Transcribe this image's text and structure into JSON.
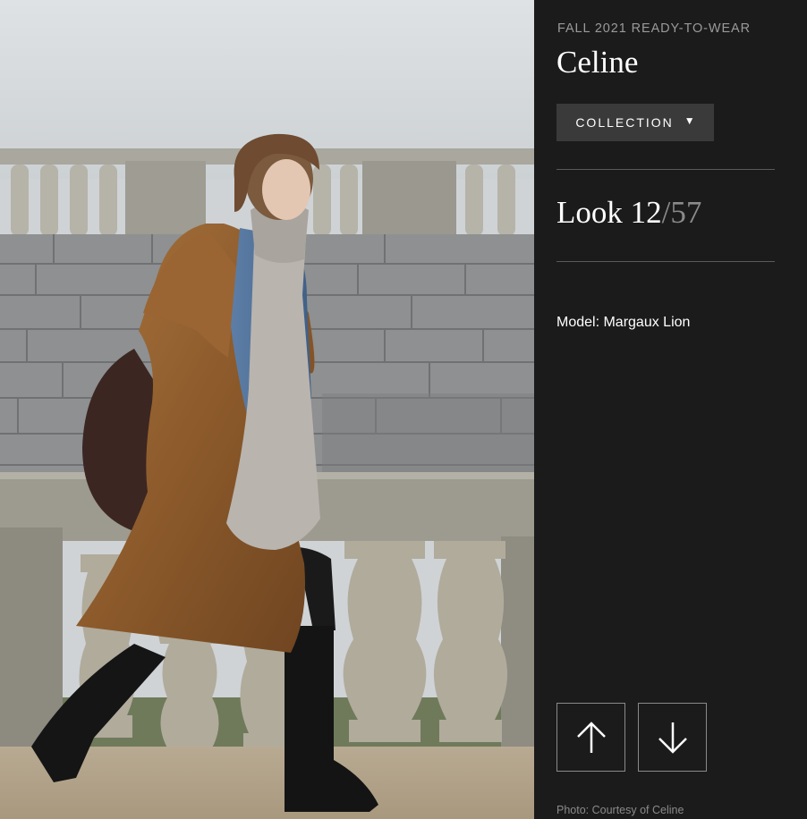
{
  "header": {
    "season": "FALL 2021 READY-TO-WEAR",
    "brand": "Celine"
  },
  "collection_button": {
    "label": "COLLECTION",
    "caret": "▼"
  },
  "look": {
    "prefix": "Look",
    "current": "12",
    "separator": "/",
    "total": "57"
  },
  "model": {
    "text": "Model: Margaux Lion"
  },
  "navigation": {
    "up_icon": "arrow-up-icon",
    "down_icon": "arrow-down-icon"
  },
  "credit": {
    "text": "Photo: Courtesy of Celine"
  },
  "colors": {
    "sidebar_bg": "#1b1b1b",
    "button_bg": "#3a3a3a",
    "muted_text": "#9a9a9a"
  }
}
